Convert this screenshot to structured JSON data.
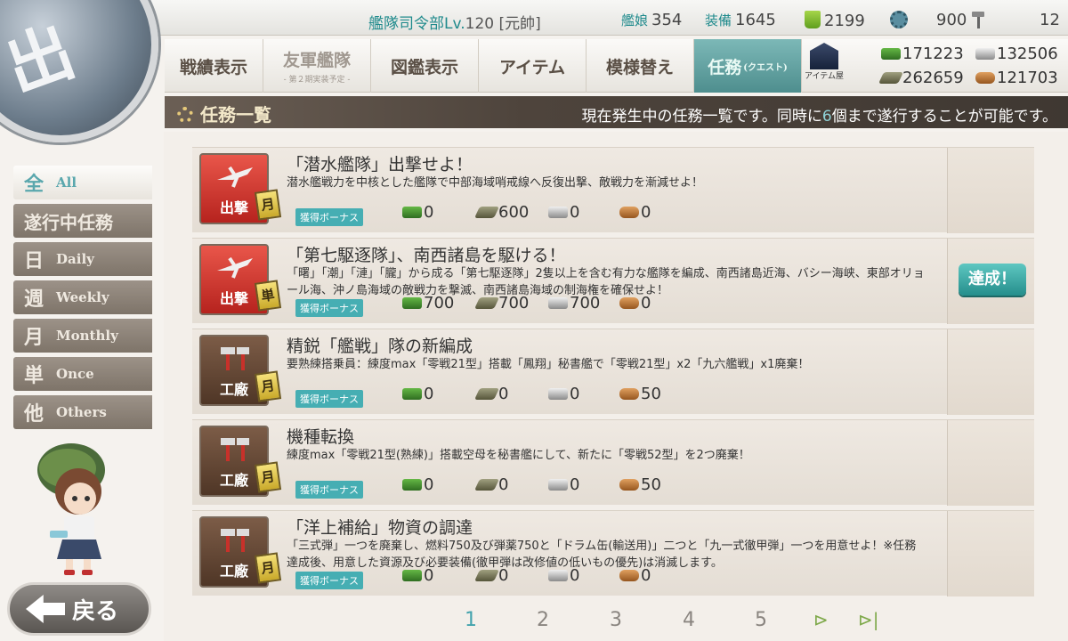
{
  "topbar": {
    "hq_label": "艦隊司令部Lv.",
    "hq_level": "120",
    "rank": "[元帥]",
    "ships_label": "艦娘",
    "ships_value": "354",
    "equip_label": "装備",
    "equip_value": "1645",
    "bucket_value": "2199",
    "devmat_value": "900",
    "screw_value": "12"
  },
  "nav": {
    "tabs": [
      {
        "label": "戦績表示",
        "sub": ""
      },
      {
        "label": "友軍艦隊",
        "sub": "- 第２期実装予定 -"
      },
      {
        "label": "図鑑表示",
        "sub": ""
      },
      {
        "label": "アイテム",
        "sub": ""
      },
      {
        "label": "模様替え",
        "sub": ""
      },
      {
        "label": "任務",
        "sub": "(クエスト)"
      }
    ],
    "item_shop_label": "アイテム屋"
  },
  "resources": {
    "fuel": "171223",
    "steel": "132506",
    "ammo": "262659",
    "bauxite": "121703"
  },
  "header": {
    "title": "任務一覧",
    "desc_pre": "現在発生中の任務一覧です。同時に",
    "desc_num": "6",
    "desc_post": "個まで遂行することが可能です。"
  },
  "sidebar": {
    "items": [
      {
        "kanji": "全",
        "english": "All"
      },
      {
        "kanji": "遂行中任務",
        "english": ""
      },
      {
        "kanji": "日",
        "english": "Daily"
      },
      {
        "kanji": "週",
        "english": "Weekly"
      },
      {
        "kanji": "月",
        "english": "Monthly"
      },
      {
        "kanji": "単",
        "english": "Once"
      },
      {
        "kanji": "他",
        "english": "Others"
      }
    ]
  },
  "back_label": "戻る",
  "bonus_label": "獲得ボーナス",
  "quests": [
    {
      "category": "出撃",
      "freq": "月",
      "title": "「潜水艦隊」出撃せよ！",
      "desc": "潜水艦戦力を中核とした艦隊で中部海域哨戒線へ反復出撃、敵戦力を漸減せよ！",
      "rewards": [
        "0",
        "600",
        "0",
        "0"
      ],
      "status": ""
    },
    {
      "category": "出撃",
      "freq": "単",
      "title": "「第七駆逐隊」、南西諸島を駆ける！",
      "desc": "「曙」「潮」「漣」「朧」から成る「第七駆逐隊」2隻以上を含む有力な艦隊を編成、南西諸島近海、バシー海峡、東部オリョール海、沖ノ島海域の敵戦力を撃滅、南西諸島海域の制海権を確保せよ！",
      "rewards": [
        "700",
        "700",
        "700",
        "0"
      ],
      "status": "達成！"
    },
    {
      "category": "工廠",
      "freq": "月",
      "title": "精鋭「艦戦」隊の新編成",
      "desc": "要熟練搭乗員：練度max「零戦21型」搭載「鳳翔」秘書艦で「零戦21型」x2「九六艦戦」x1廃棄！",
      "rewards": [
        "0",
        "0",
        "0",
        "50"
      ],
      "status": ""
    },
    {
      "category": "工廠",
      "freq": "月",
      "title": "機種転換",
      "desc": "練度max「零戦21型(熟練)」搭載空母を秘書艦にして、新たに「零戦52型」を2つ廃棄！",
      "rewards": [
        "0",
        "0",
        "0",
        "50"
      ],
      "status": ""
    },
    {
      "category": "工廠",
      "freq": "月",
      "title": "「洋上補給」物資の調達",
      "desc": "「三式弾」一つを廃棄し、燃料750及び弾薬750と「ドラム缶(輸送用)」二つと「九一式徹甲弾」一つを用意せよ！※任務達成後、用意した資源及び必要装備(徹甲弾は改修値の低いもの優先)は消滅します。",
      "rewards": [
        "0",
        "0",
        "0",
        "0"
      ],
      "status": ""
    }
  ],
  "pager": {
    "pages": [
      "1",
      "2",
      "3",
      "4",
      "5"
    ],
    "current": "1"
  }
}
